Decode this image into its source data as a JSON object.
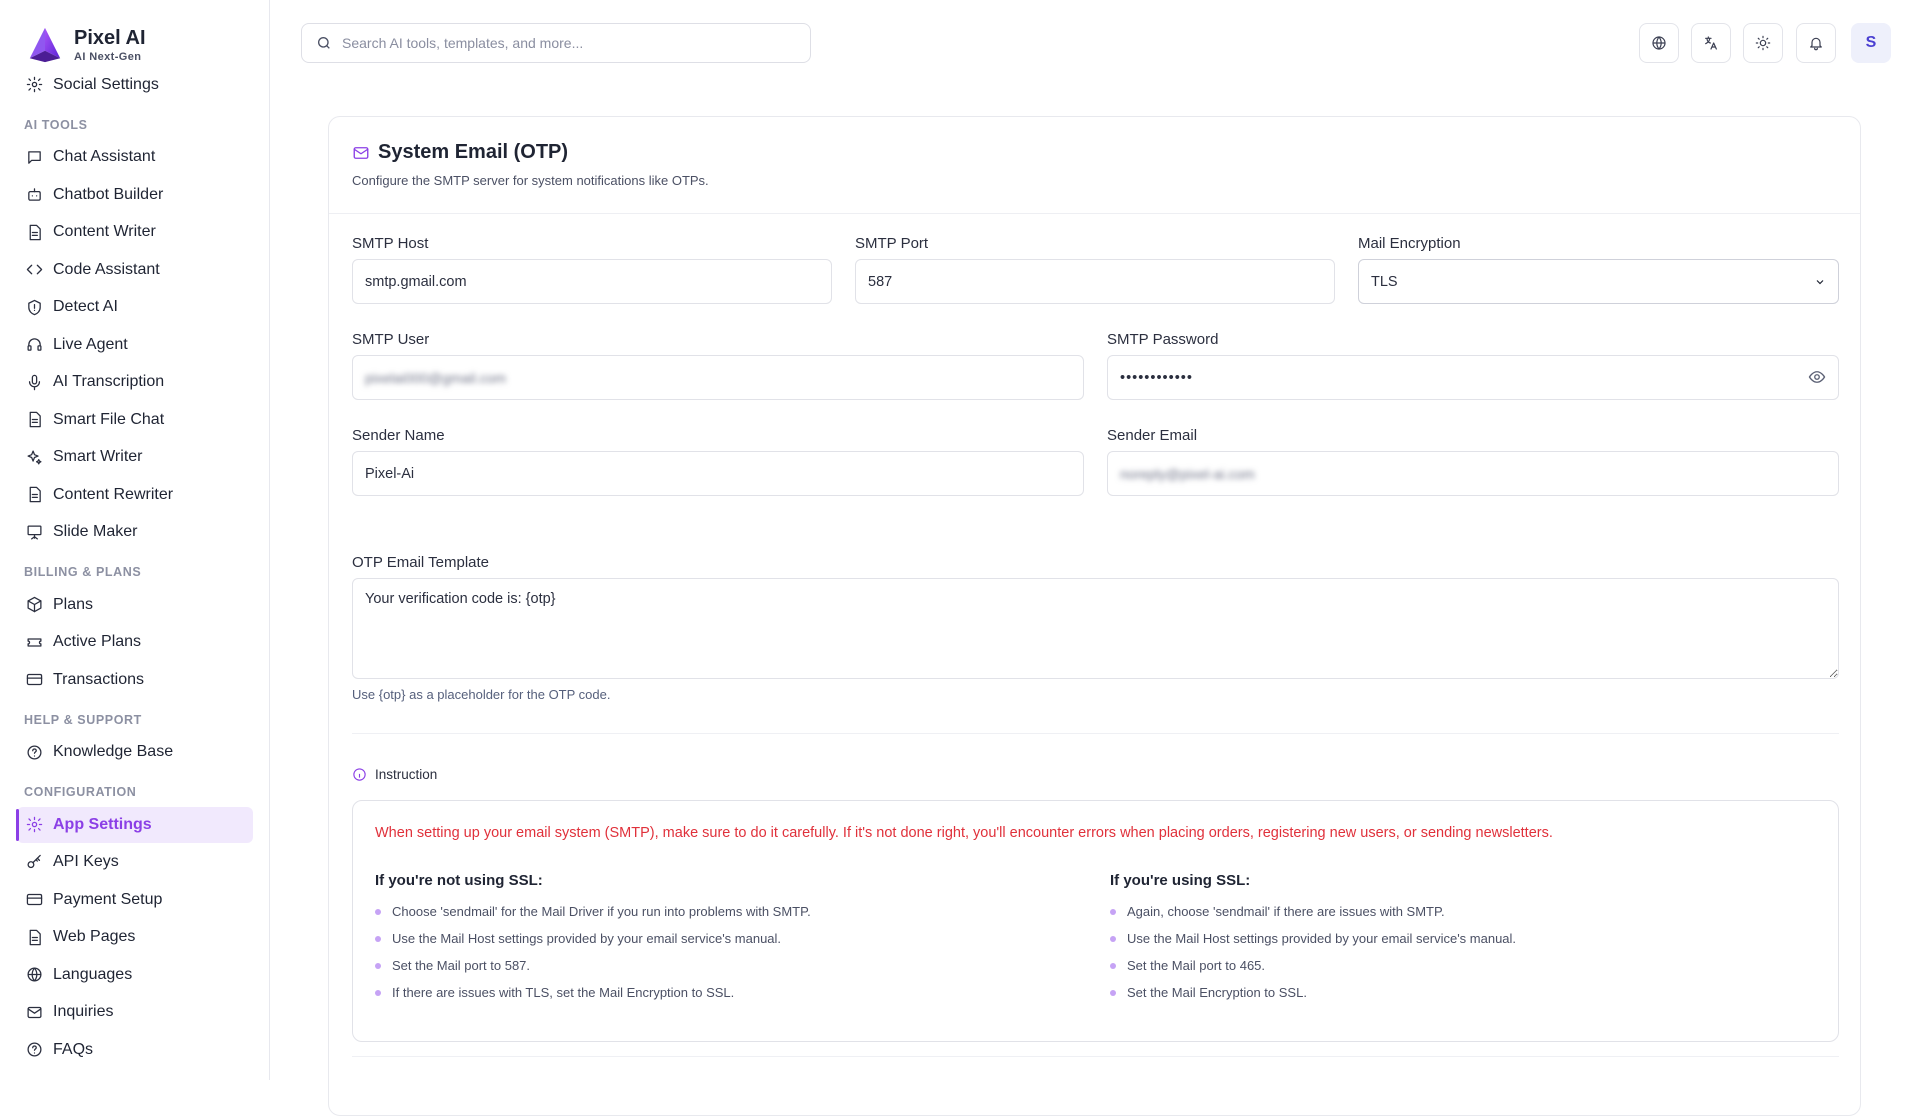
{
  "brand": {
    "name": "Pixel AI",
    "tagline": "AI Next-Gen"
  },
  "sidebar": {
    "top_items": [
      {
        "label": "Social Settings",
        "icon": "gear-icon"
      }
    ],
    "sections": [
      {
        "title": "AI TOOLS",
        "items": [
          {
            "label": "Chat Assistant",
            "icon": "chat-icon"
          },
          {
            "label": "Chatbot Builder",
            "icon": "bot-icon"
          },
          {
            "label": "Content Writer",
            "icon": "document-icon"
          },
          {
            "label": "Code Assistant",
            "icon": "code-icon"
          },
          {
            "label": "Detect AI",
            "icon": "shield-icon"
          },
          {
            "label": "Live Agent",
            "icon": "headset-icon"
          },
          {
            "label": "AI Transcription",
            "icon": "microphone-icon"
          },
          {
            "label": "Smart File Chat",
            "icon": "document-icon"
          },
          {
            "label": "Smart Writer",
            "icon": "sparkles-icon"
          },
          {
            "label": "Content Rewriter",
            "icon": "document-icon"
          },
          {
            "label": "Slide Maker",
            "icon": "presentation-icon"
          }
        ]
      },
      {
        "title": "BILLING & PLANS",
        "items": [
          {
            "label": "Plans",
            "icon": "package-icon"
          },
          {
            "label": "Active Plans",
            "icon": "ticket-icon"
          },
          {
            "label": "Transactions",
            "icon": "credit-card-icon"
          }
        ]
      },
      {
        "title": "HELP & SUPPORT",
        "items": [
          {
            "label": "Knowledge Base",
            "icon": "help-circle-icon"
          }
        ]
      },
      {
        "title": "CONFIGURATION",
        "items": [
          {
            "label": "App Settings",
            "icon": "gear-icon",
            "active": true
          },
          {
            "label": "API Keys",
            "icon": "key-icon"
          },
          {
            "label": "Payment Setup",
            "icon": "credit-card-icon"
          },
          {
            "label": "Web Pages",
            "icon": "document-icon"
          },
          {
            "label": "Languages",
            "icon": "globe-icon"
          },
          {
            "label": "Inquiries",
            "icon": "mail-icon"
          },
          {
            "label": "FAQs",
            "icon": "help-circle-icon"
          }
        ]
      }
    ]
  },
  "topbar": {
    "search_placeholder": "Search AI tools, templates, and more...",
    "buttons": [
      "globe-icon",
      "translate-icon",
      "sun-icon",
      "bell-icon"
    ],
    "avatar_initial": "S"
  },
  "card": {
    "title": "System Email (OTP)",
    "subtitle": "Configure the SMTP server for system notifications like OTPs.",
    "fields": {
      "smtp_host_label": "SMTP Host",
      "smtp_host_value": "smtp.gmail.com",
      "smtp_port_label": "SMTP Port",
      "smtp_port_value": "587",
      "encryption_label": "Mail Encryption",
      "encryption_value": "TLS",
      "smtp_user_label": "SMTP User",
      "smtp_user_value": "pixelai000@gmail.com",
      "smtp_password_label": "SMTP Password",
      "smtp_password_value": "••••••••••••",
      "sender_name_label": "Sender Name",
      "sender_name_value": "Pixel-Ai",
      "sender_email_label": "Sender Email",
      "sender_email_value": "noreply@pixel-ai.com",
      "template_label": "OTP Email Template",
      "template_value": "Your verification code is: {otp}",
      "template_hint": "Use {otp} as a placeholder for the OTP code."
    },
    "instruction": {
      "heading": "Instruction",
      "warning": "When setting up your email system (SMTP), make sure to do it carefully. If it's not done right, you'll encounter errors when placing orders, registering new users, or sending newsletters.",
      "no_ssl_title": "If you're not using SSL:",
      "no_ssl_items": [
        "Choose 'sendmail' for the Mail Driver if you run into problems with SMTP.",
        "Use the Mail Host settings provided by your email service's manual.",
        "Set the Mail port to 587.",
        "If there are issues with TLS, set the Mail Encryption to SSL."
      ],
      "ssl_title": "If you're using SSL:",
      "ssl_items": [
        "Again, choose 'sendmail' if there are issues with SMTP.",
        "Use the Mail Host settings provided by your email service's manual.",
        "Set the Mail port to 465.",
        "Set the Mail Encryption to SSL."
      ]
    }
  },
  "colors": {
    "accent": "#8b3fe6",
    "warning": "#e0313b",
    "active_bg": "#f1e9fd"
  }
}
